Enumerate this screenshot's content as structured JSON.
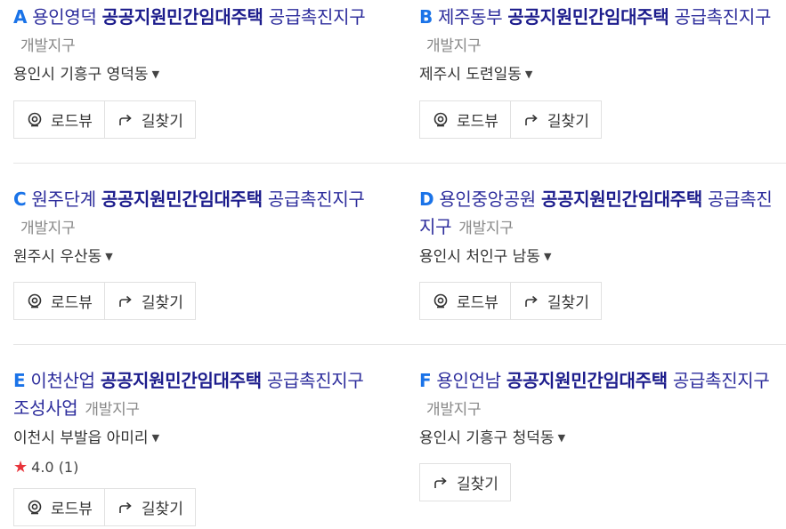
{
  "results": [
    {
      "letter": "A",
      "name": "용인영덕",
      "keyword": "공공지원민간임대주택",
      "rest": "공급촉진지구",
      "category": "개발지구",
      "address": "용인시 기흥구 영덕동",
      "rating": null,
      "buttons": [
        "로드뷰",
        "길찾기"
      ]
    },
    {
      "letter": "B",
      "name": "제주동부",
      "keyword": "공공지원민간임대주택",
      "rest": "공급촉진지구",
      "category": "개발지구",
      "address": "제주시 도련일동",
      "rating": null,
      "buttons": [
        "로드뷰",
        "길찾기"
      ]
    },
    {
      "letter": "C",
      "name": "원주단계",
      "keyword": "공공지원민간임대주택",
      "rest": "공급촉진지구",
      "category": "개발지구",
      "address": "원주시 우산동",
      "rating": null,
      "buttons": [
        "로드뷰",
        "길찾기"
      ]
    },
    {
      "letter": "D",
      "name": "용인중앙공원",
      "keyword": "공공지원민간임대주택",
      "rest": "공급촉진지구",
      "category": "개발지구",
      "address": "용인시 처인구 남동",
      "rating": null,
      "buttons": [
        "로드뷰",
        "길찾기"
      ]
    },
    {
      "letter": "E",
      "name": "이천산업",
      "keyword": "공공지원민간임대주택",
      "rest": "공급촉진지구 조성사업",
      "category": "개발지구",
      "address": "이천시 부발읍 아미리",
      "rating": {
        "score": "4.0",
        "count": "(1)"
      },
      "buttons": [
        "로드뷰",
        "길찾기"
      ]
    },
    {
      "letter": "F",
      "name": "용인언남",
      "keyword": "공공지원민간임대주택",
      "rest": "공급촉진지구",
      "category": "개발지구",
      "address": "용인시 기흥구 청덕동",
      "rating": null,
      "buttons": [
        "길찾기"
      ]
    }
  ],
  "colors": {
    "letter": "#1a73e8",
    "title": "#2d2d9c",
    "star": "#e8333a"
  },
  "icons": {
    "roadview": "roadview-icon",
    "directions": "directions-arrow-icon",
    "caret": "caret-down-icon",
    "star": "star-icon"
  }
}
